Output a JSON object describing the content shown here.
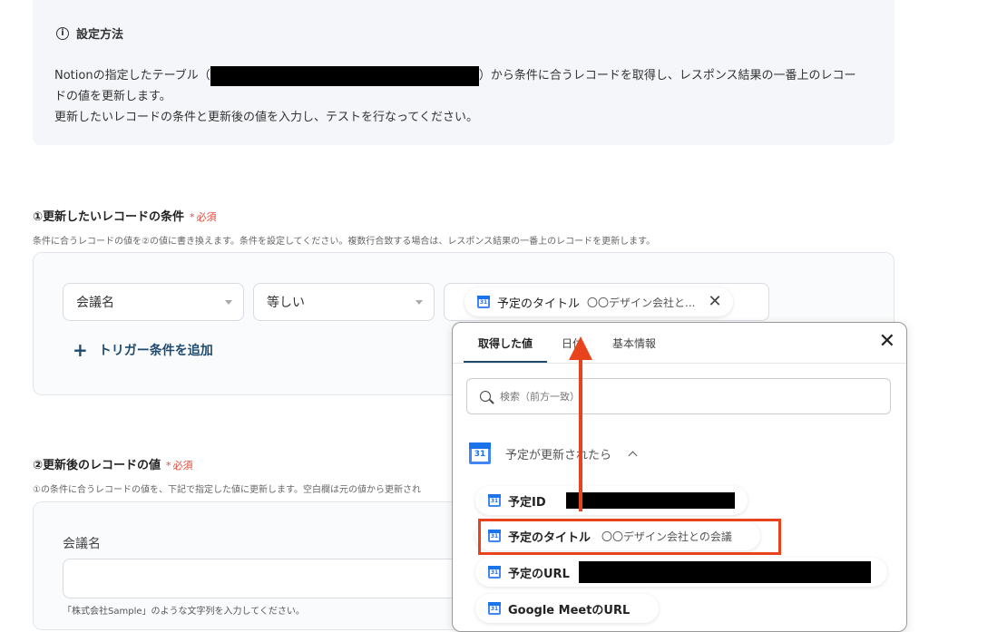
{
  "info": {
    "title": "設定方法",
    "line1_before": "Notionの指定したテーブル（",
    "line1_after": "）から条件に合うレコードを取得し、レスポンス結果の一番上のレコー",
    "line2": "ドの値を更新します。",
    "line3": "更新したいレコードの条件と更新後の値を入力し、テストを行なってください。"
  },
  "section1": {
    "title": "①更新したいレコードの条件",
    "required": "必須",
    "description": "条件に合うレコードの値を②の値に書き換えます。条件を設定してください。複数行合致する場合は、レスポンス結果の一番上のレコードを更新します。",
    "field_select": "会議名",
    "operator_select": "等しい",
    "value_chip_label": "予定のタイトル",
    "value_chip_hint": "〇〇デザイン会社と...",
    "add_trigger": "トリガー条件を追加"
  },
  "section2": {
    "title": "②更新後のレコードの値",
    "required": "必須",
    "description": "①の条件に合うレコードの値を、下記で指定した値に更新します。空白欄は元の値から更新され",
    "field_label": "会議名",
    "field_value": "",
    "field_hint": "「株式会社Sample」のような文字列を入力してください。"
  },
  "popup": {
    "tabs": [
      "取得した値",
      "日付",
      "基本情報"
    ],
    "active_tab": 0,
    "search_placeholder": "検索（前方一致）",
    "group_title": "予定が更新されたら",
    "items": [
      {
        "label": "予定ID",
        "hint": ""
      },
      {
        "label": "予定のタイトル",
        "hint": "〇〇デザイン会社との会議"
      },
      {
        "label": "予定のURL",
        "hint": ""
      },
      {
        "label": "Google MeetのURL",
        "hint": ""
      }
    ]
  },
  "colors": {
    "accent": "#1f4a6e",
    "required": "#e04a3b",
    "annotation": "#e8431c",
    "calendar_blue": "#1a73e8"
  },
  "icons": [
    "info-icon",
    "chevron-down-icon",
    "google-calendar-icon",
    "close-icon",
    "plus-icon",
    "search-icon",
    "chevron-up-icon"
  ]
}
